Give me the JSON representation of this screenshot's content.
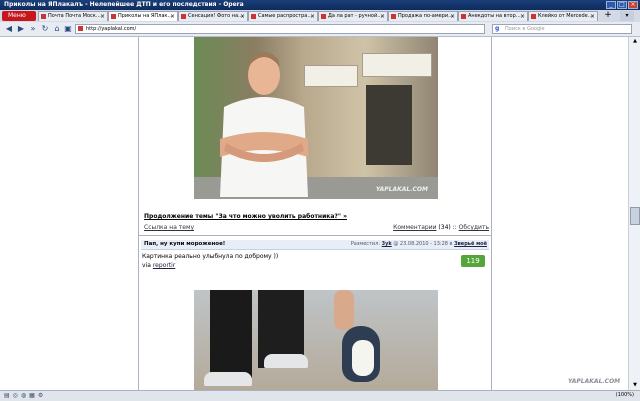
{
  "window": {
    "title": "Приколы на ЯПлакалъ - Нелепейшее ДТП и его последствия - Opera",
    "controls": [
      "minimize",
      "maximize",
      "close"
    ]
  },
  "browser": {
    "menu_label": "Меню",
    "tabs": [
      {
        "label": "Почта Почта Моск…",
        "active": false
      },
      {
        "label": "Приколы на ЯПлак…",
        "active": true
      },
      {
        "label": "Сенсация! Фото на…",
        "active": false
      },
      {
        "label": "Самые распростра…",
        "active": false
      },
      {
        "label": "Да ла рат - ручной…",
        "active": false
      },
      {
        "label": "Продажа по-амери…",
        "active": false
      },
      {
        "label": "Анекдоты на втор…",
        "active": false
      },
      {
        "label": "Клейко от Mercede…",
        "active": false
      }
    ],
    "address": "http://yaplakal.com/",
    "search_placeholder": "Поиск в Google",
    "search_engine_glyph": "g",
    "zoom": "(100%)"
  },
  "page": {
    "photo1_watermark": "YAPLAKAL.COM",
    "continue_link": "Продолжение темы \"За что можно уволить работника?\" »",
    "ref_link": "Ссылка на тему",
    "comments_label": "Комментарии",
    "comments_count": "(34)",
    "comments_sep": "::",
    "discuss_link": "Обсудить",
    "post": {
      "title": "Пап, ну купи мороженое!",
      "placed_label": "Разместил:",
      "author": "3yk",
      "date": "@ 23.08.2010 - 13:28 в",
      "subforum": "Зверьё моё",
      "text": "Картинка реально улыбнула по доброму ))",
      "via_prefix": "via",
      "via_link": "reportir",
      "rating": "119"
    },
    "photo2_watermark": "YAPLAKAL.COM"
  },
  "colors": {
    "opera_red": "#c8161d",
    "rating_green": "#55a63a",
    "titlebar_blue": "#1a3f7a"
  }
}
